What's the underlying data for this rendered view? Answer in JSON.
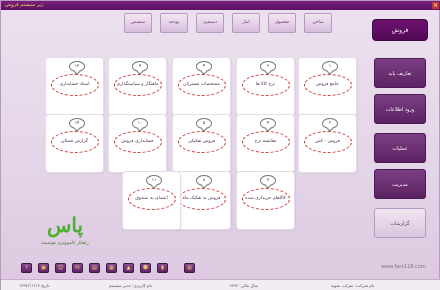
{
  "window": {
    "title": "ژیر سیستم فروش"
  },
  "topnav": [
    {
      "label": "ساخن"
    },
    {
      "label": "محصول"
    },
    {
      "label": "انبار"
    },
    {
      "label": "دستمزد"
    },
    {
      "label": "بودجه"
    },
    {
      "label": "سعمس"
    }
  ],
  "sidebar": {
    "items": [
      {
        "label": "فروش"
      },
      {
        "label": "تعاریف پایه"
      },
      {
        "label": "ورود اطلاعات"
      },
      {
        "label": "عملیات"
      },
      {
        "label": "مدیریت"
      },
      {
        "label": "گزارشات"
      }
    ]
  },
  "cards": [
    {
      "num": "۱",
      "label": "جامع فروش"
    },
    {
      "num": "۳",
      "label": "نرخ کالا ها"
    },
    {
      "num": "۴",
      "label": "مشخصات مشتریان"
    },
    {
      "num": "۹",
      "label": "ماهنگار و سیاستگذاری"
    },
    {
      "num": "۱۲",
      "label": "اسناد حسابداری"
    },
    {
      "num": "۲",
      "label": "فروش - کش"
    },
    {
      "num": "۴",
      "label": "مقایسه نرخ"
    },
    {
      "num": "۵",
      "label": "فروش تفکیکی"
    },
    {
      "num": "۱۰",
      "label": "حسابداری فروش"
    },
    {
      "num": "۱۴",
      "label": "گزارش فصلان"
    },
    {
      "num": "۷",
      "label": "کالاهای حریداری شده"
    },
    {
      "num": "۸",
      "label": "فروش به تفکیک ماه"
    },
    {
      "num": "۱۱",
      "label": "اعضای به صندوق"
    }
  ],
  "logo": {
    "mark": "پاس",
    "tagline": "راهکار کامپیوتری هوشمند"
  },
  "toolbar": {
    "icons": [
      "help",
      "folder",
      "users",
      "mail",
      "print",
      "grid",
      "lock",
      "smile",
      "chart",
      "calendar"
    ]
  },
  "url": "www.fars118.com",
  "status": {
    "date": "تاریخ ۱۳۹۶/۱۱/۱۶",
    "user": "نام کاربری: مدیر سیستم",
    "fiscal": "سال مالی: ۱۳۹۶",
    "company": "نام شرکت: شرکت نمونه"
  },
  "colors": {
    "accent": "#5b2363",
    "active": "#6e1170",
    "oval": "#d13a3a",
    "logo": "#4caf2d"
  }
}
